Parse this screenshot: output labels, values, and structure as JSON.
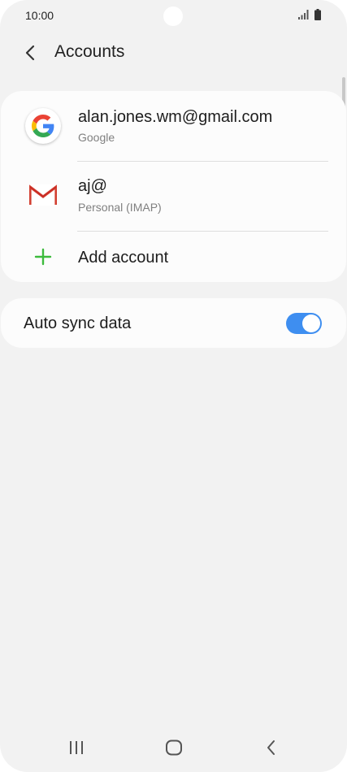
{
  "status_bar": {
    "time": "10:00",
    "signal_icon": "signal-bars-icon",
    "battery_icon": "battery-icon"
  },
  "header": {
    "back_icon": "chevron-left-icon",
    "title": "Accounts"
  },
  "accounts": [
    {
      "title": "alan.jones.wm@gmail.com",
      "subtitle": "Google",
      "icon": "google-icon"
    },
    {
      "title": "aj@",
      "subtitle": "Personal (IMAP)",
      "icon": "gmail-icon"
    }
  ],
  "add_account": {
    "label": "Add account",
    "icon": "plus-icon",
    "icon_color": "#3dbb3d"
  },
  "auto_sync": {
    "label": "Auto sync data",
    "enabled": true,
    "toggle_color": "#3e8ef0"
  },
  "nav_bar": {
    "recents_icon": "recent-apps-icon",
    "home_icon": "home-icon",
    "back_icon": "back-chevron-icon"
  }
}
